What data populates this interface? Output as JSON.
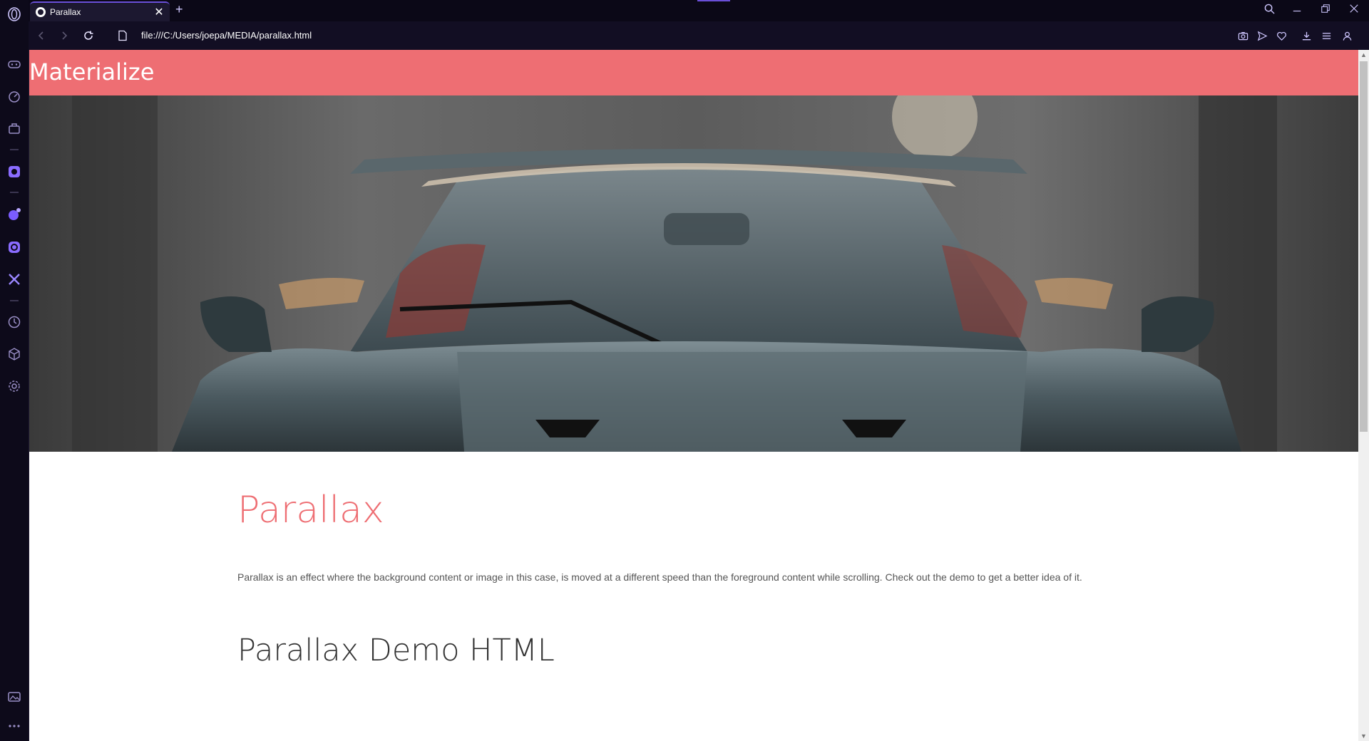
{
  "browser": {
    "tab": {
      "title": "Parallax"
    },
    "new_tab_label": "+",
    "address": {
      "url": "file:///C:/Users/joepa/MEDIA/parallax.html"
    }
  },
  "page": {
    "navbar": {
      "brand": "Materialize"
    },
    "heading": "Parallax",
    "description": "Parallax is an effect where the background content or image in this case, is moved at a different speed than the foreground content while scrolling. Check out the demo to get a better idea of it.",
    "subheading": "Parallax Demo HTML"
  },
  "colors": {
    "accent": "#ee6e73",
    "browser_accent": "#6a4fd8"
  },
  "icons": {
    "sidebar": [
      "opera-logo-icon",
      "controller-icon",
      "speed-dial-icon",
      "bag-icon",
      "messenger-icon",
      "ai-icon",
      "instagram-icon",
      "x-icon",
      "history-icon",
      "extensions-icon",
      "settings-icon",
      "gallery-icon",
      "more-icon"
    ],
    "toolbar": [
      "camera-icon",
      "send-icon",
      "heart-icon",
      "download-icon",
      "menu-icon",
      "profile-icon"
    ]
  }
}
